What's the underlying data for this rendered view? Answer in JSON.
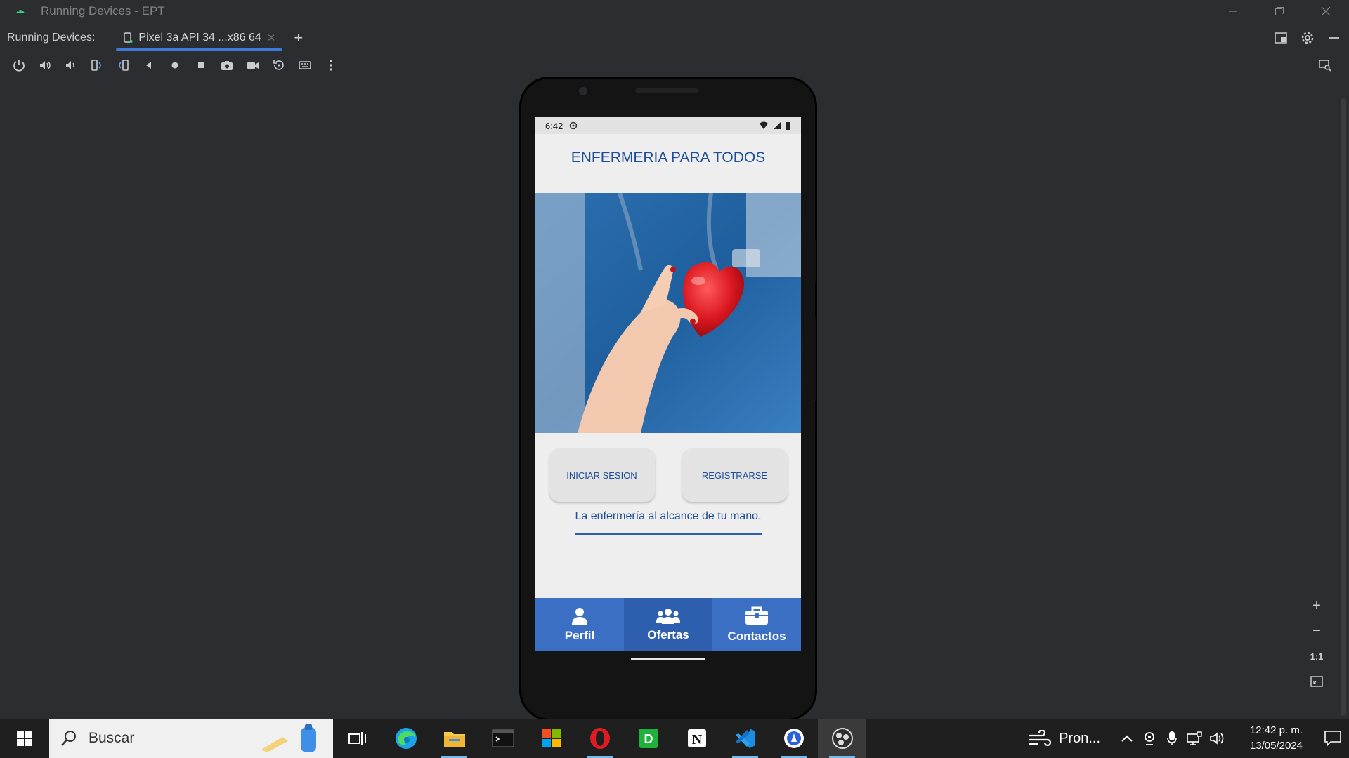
{
  "window": {
    "title": "Running Devices - EPT",
    "controls": [
      "minimize",
      "restore",
      "close"
    ]
  },
  "tabs_bar": {
    "label": "Running Devices:",
    "active_tab": "Pixel 3a API 34 ...x86 64",
    "add_symbol": "+"
  },
  "toolbar": {
    "icons": [
      "power-icon",
      "volume-up-icon",
      "volume-down-icon",
      "rotate-left-icon",
      "rotate-right-icon",
      "back-icon",
      "home-icon",
      "overview-icon",
      "screenshot-icon",
      "screen-record-icon",
      "snapshot-icon",
      "keyboard-icon",
      "more-options-icon"
    ]
  },
  "zoom_panel": {
    "zoom_in": "+",
    "zoom_out": "−",
    "actual_size": "1:1"
  },
  "device": {
    "status_time": "6:42",
    "app_title": "ENFERMERIA PARA TODOS",
    "login_label": "INICIAR SESION",
    "register_label": "REGISTRARSE",
    "tagline": "La enfermería al alcance de tu mano.",
    "nav": [
      {
        "label": "Perfil",
        "icon": "person-icon"
      },
      {
        "label": "Ofertas",
        "icon": "group-icon"
      },
      {
        "label": "Contactos",
        "icon": "briefcase-icon"
      }
    ],
    "active_nav": "Ofertas",
    "colors": {
      "primary": "#1e4d9a",
      "nav": "#3b6fc4",
      "nav_active": "#2e5fae"
    }
  },
  "taskbar": {
    "search_placeholder": "Buscar",
    "apps": [
      "task-view-icon",
      "edge-icon",
      "file-explorer-icon",
      "terminal-icon",
      "microsoft-store-icon",
      "opera-icon",
      "d-app-icon",
      "notion-icon",
      "vscode-icon",
      "app-icon",
      "obs-icon"
    ],
    "weather_text": "Pron...",
    "clock_time": "12:42 p. m.",
    "clock_date": "13/05/2024"
  }
}
